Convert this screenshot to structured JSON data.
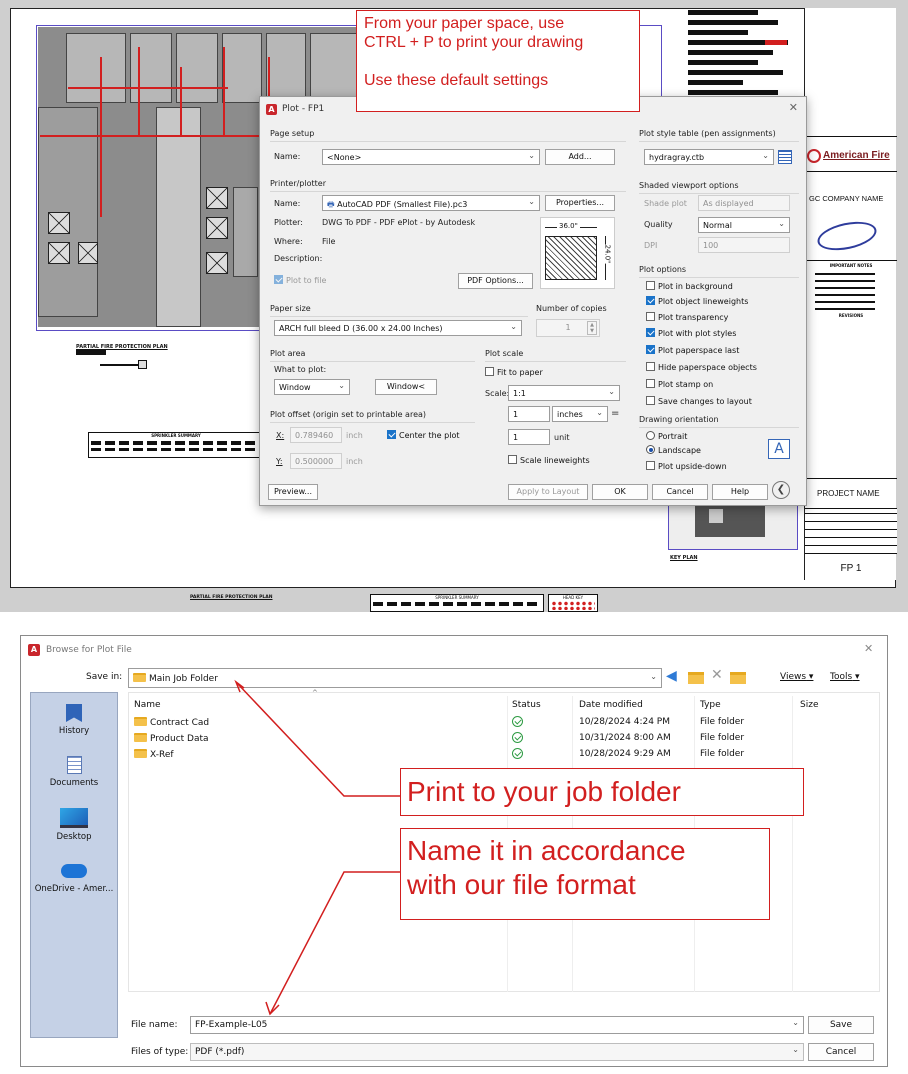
{
  "drawing": {
    "plan_title": "PARTIAL FIRE PROTECTION PLAN",
    "summary_title": "SPRINKLER SUMMARY",
    "header_label": "HEAD KEY",
    "key_plan": "KEY PLAN",
    "titleblock": {
      "company": "American Fire",
      "gc": "GC COMPANY NAME",
      "notes": "IMPORTANT NOTES",
      "revisions": "REVISIONS",
      "project": "PROJECT NAME",
      "sheet": "FP 1"
    }
  },
  "callouts": {
    "top": {
      "line1": "From your paper space, use",
      "line2": "CTRL + P to print your drawing",
      "line3": "Use these default settings"
    },
    "folder": "Print to your job folder",
    "name1": "Name it in accordance",
    "name2": "with our file format"
  },
  "plot": {
    "title": "Plot - FP1",
    "page_setup": {
      "group": "Page setup",
      "name_label": "Name:",
      "name_value": "<None>",
      "add": "Add..."
    },
    "printer": {
      "group": "Printer/plotter",
      "name_label": "Name:",
      "name_value": "AutoCAD PDF (Smallest File).pc3",
      "properties": "Properties...",
      "plotter_label": "Plotter:",
      "plotter_value": "DWG To PDF - PDF ePlot - by Autodesk",
      "where_label": "Where:",
      "where_value": "File",
      "desc_label": "Description:",
      "plot_to_file": "Plot to file",
      "pdf_options": "PDF Options...",
      "dim_w": "36.0\"",
      "dim_h": "24.0\""
    },
    "paper": {
      "group": "Paper size",
      "value": "ARCH full bleed D (36.00 x 24.00 Inches)"
    },
    "copies": {
      "label": "Number of copies",
      "value": "1"
    },
    "area": {
      "group": "Plot area",
      "what_label": "What to plot:",
      "what_value": "Window",
      "window_btn": "Window<"
    },
    "offset": {
      "group": "Plot offset (origin set to printable area)",
      "x_label": "X:",
      "x_value": "0.789460",
      "y_label": "Y:",
      "y_value": "0.500000",
      "unit": "inch",
      "center": "Center the plot"
    },
    "scale": {
      "group": "Plot scale",
      "fit": "Fit to paper",
      "scale_label": "Scale:",
      "scale_value": "1:1",
      "v1": "1",
      "units": "inches",
      "v2": "1",
      "unit2": "unit",
      "lineweights": "Scale lineweights"
    },
    "style": {
      "group": "Plot style table (pen assignments)",
      "value": "hydragray.ctb"
    },
    "shaded": {
      "group": "Shaded viewport options",
      "shade_label": "Shade plot",
      "shade_value": "As displayed",
      "quality_label": "Quality",
      "quality_value": "Normal",
      "dpi_label": "DPI",
      "dpi_value": "100"
    },
    "options": {
      "group": "Plot options",
      "items": [
        "Plot in background",
        "Plot object lineweights",
        "Plot transparency",
        "Plot with plot styles",
        "Plot paperspace last",
        "Hide paperspace objects",
        "Plot stamp on",
        "Save changes to layout"
      ]
    },
    "orientation": {
      "group": "Drawing orientation",
      "portrait": "Portrait",
      "landscape": "Landscape",
      "upside": "Plot upside-down"
    },
    "buttons": {
      "preview": "Preview...",
      "apply": "Apply to Layout",
      "ok": "OK",
      "cancel": "Cancel",
      "help": "Help"
    }
  },
  "browse": {
    "title": "Browse for Plot File",
    "save_in_label": "Save in:",
    "save_in_value": "Main Job Folder",
    "views": "Views",
    "tools": "Tools",
    "places": [
      "History",
      "Documents",
      "Desktop",
      "OneDrive - Amer..."
    ],
    "columns": [
      "Name",
      "Status",
      "Date modified",
      "Type",
      "Size"
    ],
    "files": [
      {
        "name": "Contract Cad",
        "date": "10/28/2024 4:24 PM",
        "type": "File folder"
      },
      {
        "name": "Product Data",
        "date": "10/31/2024 8:00 AM",
        "type": "File folder"
      },
      {
        "name": "X-Ref",
        "date": "10/28/2024 9:29 AM",
        "type": "File folder"
      }
    ],
    "file_name_label": "File name:",
    "file_name_value": "FP-Example-L05",
    "file_type_label": "Files of type:",
    "file_type_value": "PDF (*.pdf)",
    "save": "Save",
    "cancel": "Cancel"
  }
}
